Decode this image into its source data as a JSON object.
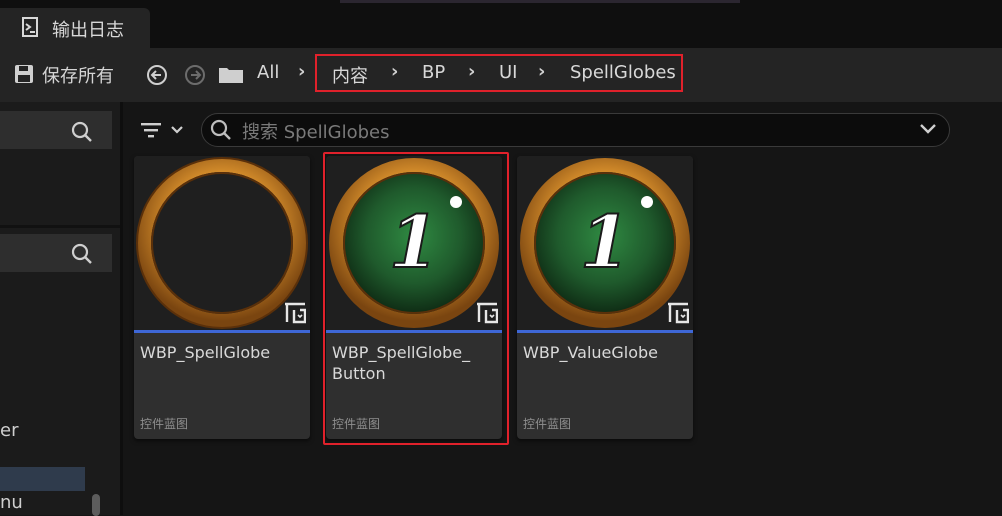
{
  "tab": {
    "title": "输出日志"
  },
  "toolbar": {
    "save_all_label": "保存所有",
    "breadcrumb": [
      "All",
      "内容",
      "BP",
      "UI",
      "SpellGlobes"
    ]
  },
  "sidebar": {
    "fragment_1": "er",
    "fragment_2": "nu"
  },
  "search": {
    "placeholder": "搜索 SpellGlobes"
  },
  "assets": [
    {
      "name": "WBP_SpellGlobe",
      "type": "控件蓝图",
      "thumbnail": "empty-golden-ring",
      "selected": false
    },
    {
      "name": "WBP_SpellGlobe_\nButton",
      "type": "控件蓝图",
      "thumbnail": "green-globe-numeral",
      "numeral": "1",
      "selected": true
    },
    {
      "name": "WBP_ValueGlobe",
      "type": "控件蓝图",
      "thumbnail": "green-globe-numeral",
      "numeral": "1",
      "selected": false
    }
  ],
  "colors": {
    "highlight": "#e0212b",
    "asset_underline": "#3e67d6",
    "panel": "#242424",
    "ring_gold": "#d18a2a",
    "globe_green": "#1f5a2c"
  },
  "icons": [
    "terminal-icon",
    "save-icon",
    "back-arrow-icon",
    "forward-arrow-icon",
    "folder-icon",
    "chevron-right-icon",
    "search-icon",
    "filter-icon",
    "chevron-down-icon",
    "widget-blueprint-icon"
  ]
}
